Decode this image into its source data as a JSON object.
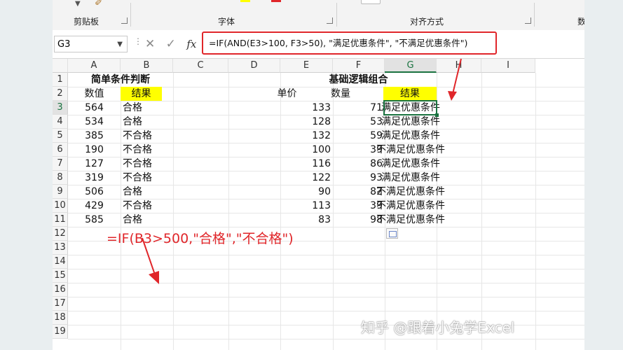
{
  "ribbon": {
    "groups": [
      {
        "label": "剪贴板"
      },
      {
        "label": "字体"
      },
      {
        "label": "对齐方式"
      },
      {
        "label": "数"
      }
    ]
  },
  "formula_bar": {
    "name_box": "G3",
    "fx_label": "fx",
    "formula": "=IF(AND(E3>100, F3>50), \"满足优惠条件\", \"不满足优惠条件\")"
  },
  "columns": [
    "A",
    "B",
    "C",
    "D",
    "E",
    "F",
    "G",
    "H",
    "I"
  ],
  "rows": [
    "1",
    "2",
    "3",
    "4",
    "5",
    "6",
    "7",
    "8",
    "9",
    "10",
    "11",
    "12",
    "13",
    "14",
    "15",
    "16",
    "17",
    "18",
    "19"
  ],
  "table1": {
    "title": "简单条件判断",
    "header_value": "数值",
    "header_result": "结果",
    "values": [
      "564",
      "534",
      "385",
      "190",
      "127",
      "319",
      "506",
      "429",
      "585"
    ],
    "results": [
      "合格",
      "合格",
      "不合格",
      "不合格",
      "不合格",
      "不合格",
      "合格",
      "不合格",
      "合格"
    ]
  },
  "table2": {
    "title": "基础逻辑组合",
    "header_price": "单价",
    "header_qty": "数量",
    "header_result": "结果",
    "prices": [
      "133",
      "128",
      "132",
      "100",
      "116",
      "122",
      "90",
      "113",
      "83"
    ],
    "qtys": [
      "71",
      "53",
      "59",
      "39",
      "86",
      "93",
      "82",
      "39",
      "98"
    ],
    "results": [
      "满足优惠条件",
      "满足优惠条件",
      "满足优惠条件",
      "不满足优惠条件",
      "满足优惠条件",
      "满足优惠条件",
      "不满足优惠条件",
      "不满足优惠条件",
      "不满足优惠条件"
    ]
  },
  "annotation": "=IF(B3>500,\"合格\",\"不合格\")",
  "watermark": "知乎 @跟着小兔学Excel",
  "colors": {
    "accent_red": "#e0262a",
    "select_green": "#1a7340",
    "highlight_yellow": "#ffff00"
  }
}
